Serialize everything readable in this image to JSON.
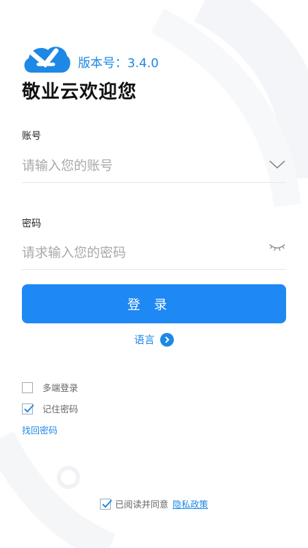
{
  "header": {
    "version": "版本号：3.4.0",
    "welcome": "敬业云欢迎您"
  },
  "account": {
    "label": "账号",
    "placeholder": "请输入您的账号"
  },
  "password": {
    "label": "密码",
    "placeholder": "请求输入您的密码"
  },
  "login_button": "登录",
  "language_link": "语言",
  "options": {
    "multi_login": {
      "label": "多端登录",
      "checked": false
    },
    "remember_password": {
      "label": "记住密码",
      "checked": true
    }
  },
  "find_password": "找回密码",
  "agreement": {
    "text": "已阅读并同意",
    "policy_link": "隐私政策",
    "checked": true
  },
  "colors": {
    "accent": "#1e88e5",
    "button": "#1e88f5"
  }
}
